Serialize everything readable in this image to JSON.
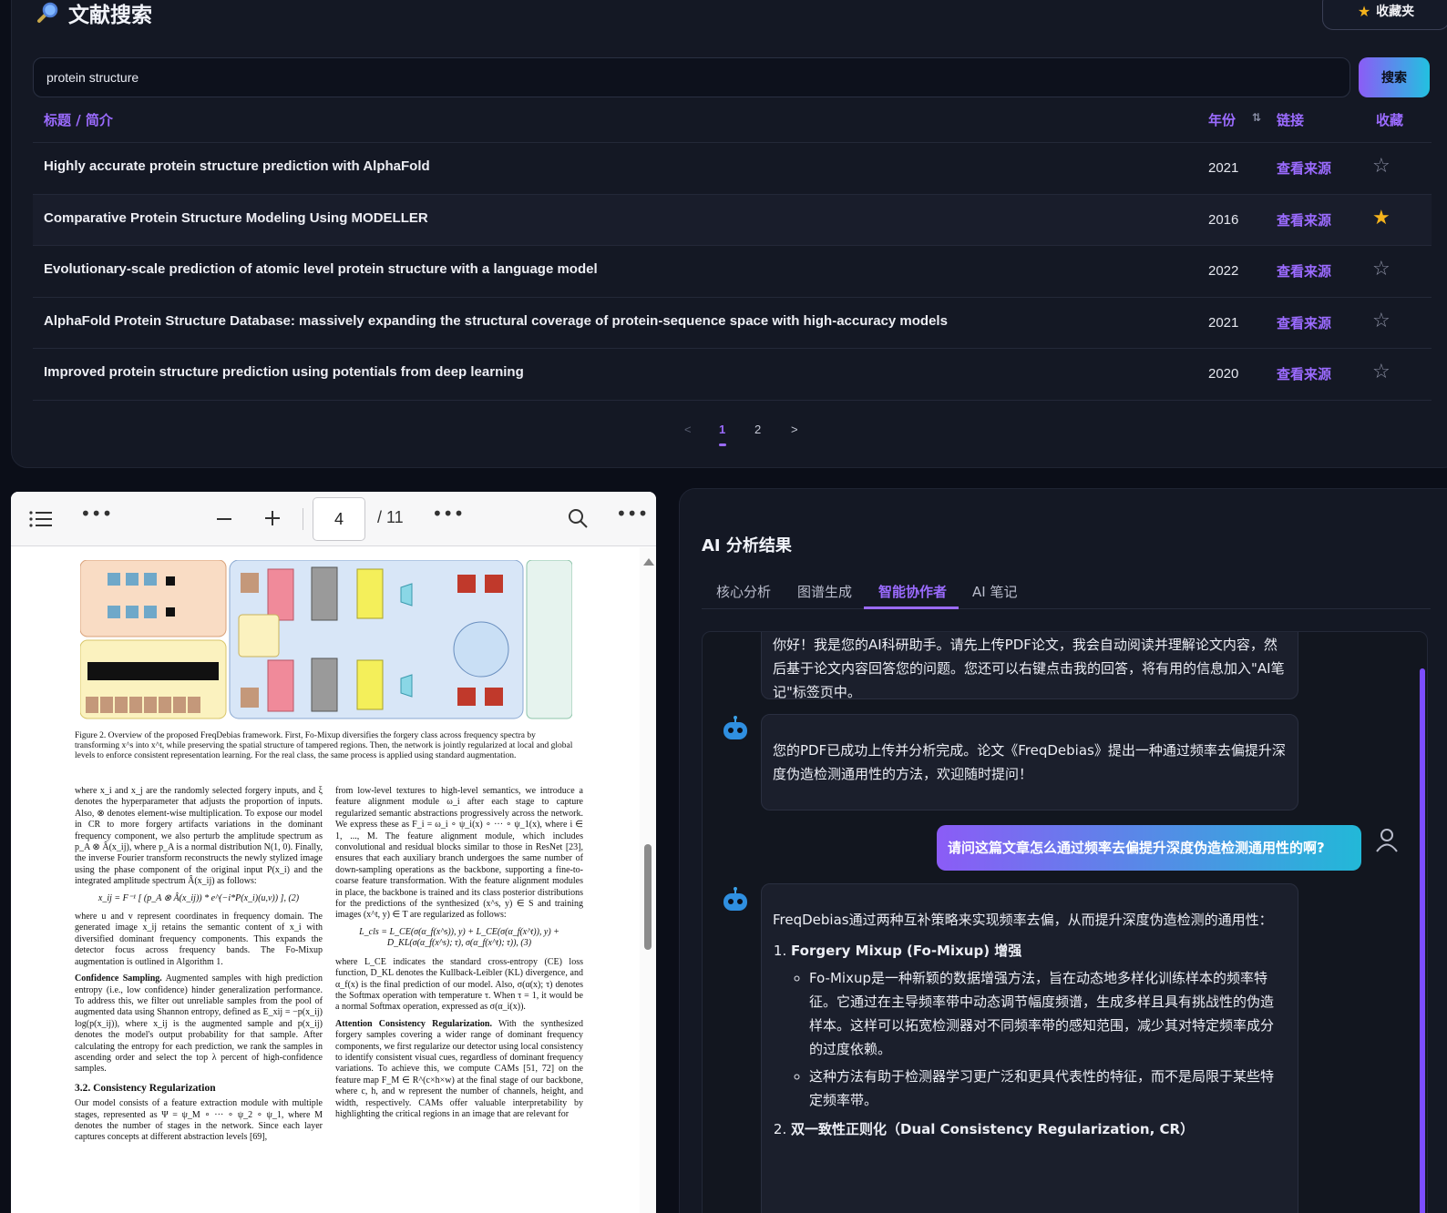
{
  "search": {
    "title": "文献搜索",
    "favorites_label": "收藏夹",
    "query": "protein structure",
    "button_label": "搜索"
  },
  "table": {
    "headers": {
      "title": "标题 / 简介",
      "year": "年份",
      "link": "链接",
      "fav": "收藏"
    },
    "rows": [
      {
        "title": "Highly accurate protein structure prediction with AlphaFold",
        "year": "2021",
        "link": "查看来源",
        "fav": "☆"
      },
      {
        "title": "Comparative Protein Structure Modeling Using MODELLER",
        "year": "2016",
        "link": "查看来源",
        "fav": "★"
      },
      {
        "title": "Evolutionary-scale prediction of atomic level protein structure with a language model",
        "year": "2022",
        "link": "查看来源",
        "fav": "☆"
      },
      {
        "title": "AlphaFold Protein Structure Database: massively expanding the structural coverage of protein-sequence space with high-accuracy models",
        "year": "2021",
        "link": "查看来源",
        "fav": "☆"
      },
      {
        "title": "Improved protein structure prediction using potentials from deep learning",
        "year": "2020",
        "link": "查看来源",
        "fav": "☆"
      }
    ]
  },
  "pagination": {
    "prev": "<",
    "pages": [
      "1",
      "2"
    ],
    "current": "1",
    "next": ">"
  },
  "pdf": {
    "current_page": "4",
    "total_pages": "/ 11",
    "caption": "Figure 2. Overview of the proposed FreqDebias framework. First, Fo-Mixup diversifies the forgery class across frequency spectra by transforming x^s into x^t, while preserving the spatial structure of tampered regions. Then, the network is jointly regularized at local and global levels to enforce consistent representation learning. For the real class, the same process is applied using standard augmentation.",
    "left_col_p1": "where x_i and x_j are the randomly selected forgery inputs, and ξ denotes the hyperparameter that adjusts the proportion of inputs. Also, ⊗ denotes element-wise multiplication. To expose our model in CR to more forgery artifacts variations in the dominant frequency component, we also perturb the amplitude spectrum as p_A ⊗ Â(x_ij), where p_A is a normal distribution N(1, 0). Finally, the inverse Fourier transform reconstructs the newly stylized image using the phase component of the original input P(x_i) and the integrated amplitude spectrum Â(x_ij) as follows:",
    "left_eq": "x_ij = F⁻¹ [ (p_A ⊗ Â(x_ij)) * e^(−i*P(x_i)(u,v)) ],     (2)",
    "left_col_p2": "where u and v represent coordinates in frequency domain. The generated image x_ij retains the semantic content of x_i with diversified dominant frequency components. This expands the detector focus across frequency bands. The Fo-Mixup augmentation is outlined in Algorithm 1.",
    "left_col_p3_head": "Confidence Sampling.",
    "left_col_p3": "Augmented samples with high prediction entropy (i.e., low confidence) hinder generalization performance. To address this, we filter out unreliable samples from the pool of augmented data using Shannon entropy, defined as E_xij = −p(x_ij) log(p(x_ij)), where x_ij is the augmented sample and p(x_ij) denotes the model's output probability for that sample. After calculating the entropy for each prediction, we rank the samples in ascending order and select the top λ percent of high-confidence samples.",
    "left_section": "3.2. Consistency Regularization",
    "left_col_p4": "Our model consists of a feature extraction module with multiple stages, represented as Ψ = ψ_M ∘ ··· ∘ ψ_2 ∘ ψ_1, where M denotes the number of stages in the network. Since each layer captures concepts at different abstraction levels [69],",
    "right_col_p1": "from low-level textures to high-level semantics, we introduce a feature alignment module ω_i after each stage to capture regularized semantic abstractions progressively across the network. We express these as F_i = ω_i ∘ ψ_i(x) ∘ ··· ∘ ψ_1(x), where i ∈ 1, ..., M. The feature alignment module, which includes convolutional and residual blocks similar to those in ResNet [23], ensures that each auxiliary branch undergoes the same number of down-sampling operations as the backbone, supporting a fine-to-coarse feature transformation. With the feature alignment modules in place, the backbone is trained and its class posterior distributions for the predictions of the synthesized (x^s, y) ∈ S and training images (x^t, y) ∈ T are regularized as follows:",
    "right_eq": "L_cls = L_CE(σ(α_f(x^s)), y) + L_CE(σ(α_f(x^t)), y) + D_KL(σ(α_f(x^s); τ), σ(α_f(x^t); τ)),   (3)",
    "right_col_p2": "where L_CE indicates the standard cross-entropy (CE) loss function, D_KL denotes the Kullback-Leibler (KL) divergence, and α_f(x) is the final prediction of our model. Also, σ(α(x); τ) denotes the Softmax operation with temperature τ. When τ = 1, it would be a normal Softmax operation, expressed as σ(α_i(x)).",
    "right_col_p3_head": "Attention Consistency Regularization.",
    "right_col_p3": "With the synthesized forgery samples covering a wider range of dominant frequency components, we first regularize our detector using local consistency to identify consistent visual cues, regardless of dominant frequency variations. To achieve this, we compute CAMs [51, 72] on the feature map F_M ∈ R^(c×h×w) at the final stage of our backbone, where c, h, and w represent the number of channels, height, and width, respectively. CAMs offer valuable interpretability by highlighting the critical regions in an image that are relevant for"
  },
  "ai": {
    "title": "AI 分析结果",
    "tabs": [
      "核心分析",
      "图谱生成",
      "智能协作者",
      "AI 笔记"
    ],
    "active_tab": "智能协作者",
    "msg_intro": "你好！我是您的AI科研助手。请先上传PDF论文，我会自动阅读并理解论文内容，然后基于论文内容回答您的问题。您还可以右键点击我的回答，将有用的信息加入\"AI笔记\"标签页中。",
    "msg_uploaded": "您的PDF已成功上传并分析完成。论文《FreqDebias》提出一种通过频率去偏提升深度伪造检测通用性的方法，欢迎随时提问！",
    "user_question": "请问这篇文章怎么通过频率去偏提升深度伪造检测通用性的啊?",
    "answer_intro": "FreqDebias通过两种互补策略来实现频率去偏，从而提升深度伪造检测的通用性：",
    "answer_item1_title": "Forgery Mixup (Fo-Mixup) 增强",
    "answer_item1_b1": "Fo-Mixup是一种新颖的数据增强方法，旨在动态地多样化训练样本的频率特征。它通过在主导频率带中动态调节幅度频谱，生成多样且具有挑战性的伪造样本。这样可以拓宽检测器对不同频率带的感知范围，减少其对特定频率成分的过度依赖。",
    "answer_item1_b2": "这种方法有助于检测器学习更广泛和更具代表性的特征，而不是局限于某些特定频率带。",
    "answer_item2_title": "双一致性正则化（Dual Consistency Regularization, CR）"
  },
  "colors": {
    "accent": "#9b6bff",
    "star_on": "#f5b31c",
    "background": "#0b0e18",
    "panel": "#141824"
  }
}
